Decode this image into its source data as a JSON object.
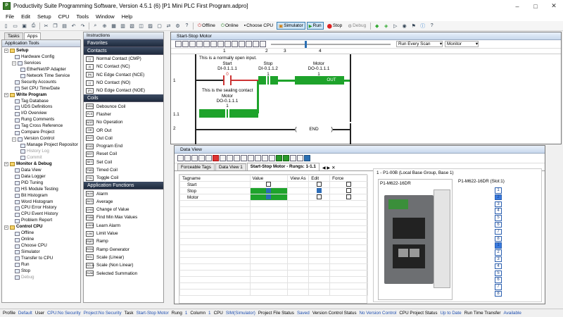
{
  "window": {
    "title": "Productivity Suite Programming Software, Version 4.5.1 (6)  [P1 Mini PLC First Program.adpro]"
  },
  "menu": [
    "File",
    "Edit",
    "Setup",
    "CPU",
    "Tools",
    "Window",
    "Help"
  ],
  "toolbar": {
    "offline": "Offline",
    "online": "Online",
    "choose_cpu": "Choose CPU",
    "simulator": "Simulator",
    "run": "Run",
    "stop": "Stop",
    "debug": "Debug"
  },
  "left_tabs": {
    "tasks": "Tasks",
    "apps": "Apps"
  },
  "app_tools": {
    "header": "Application Tools",
    "items": [
      {
        "label": "Setup",
        "type": "group"
      },
      {
        "label": "Hardware Config",
        "type": "item"
      },
      {
        "label": "Services",
        "type": "sub"
      },
      {
        "label": "EtherNet/IP Adapter",
        "type": "item2"
      },
      {
        "label": "Network Time Service",
        "type": "item2"
      },
      {
        "label": "Security Accounts",
        "type": "item"
      },
      {
        "label": "Set CPU Time/Date",
        "type": "item"
      },
      {
        "label": "Write Program",
        "type": "group"
      },
      {
        "label": "Tag Database",
        "type": "item"
      },
      {
        "label": "UDS Definitions",
        "type": "item"
      },
      {
        "label": "I/O Overview",
        "type": "item"
      },
      {
        "label": "Rung Comments",
        "type": "item"
      },
      {
        "label": "Tag Cross Reference",
        "type": "item"
      },
      {
        "label": "Compare Project",
        "type": "item"
      },
      {
        "label": "Version Control",
        "type": "sub"
      },
      {
        "label": "Manage Project Repositor",
        "type": "item2"
      },
      {
        "label": "History Log",
        "type": "item2dis"
      },
      {
        "label": "Commit",
        "type": "item2dis"
      },
      {
        "label": "Monitor & Debug",
        "type": "group"
      },
      {
        "label": "Data View",
        "type": "item"
      },
      {
        "label": "Data Logger",
        "type": "item"
      },
      {
        "label": "PID Tuning",
        "type": "item"
      },
      {
        "label": "HS Module Testing",
        "type": "item"
      },
      {
        "label": "Bit Histogram",
        "type": "item"
      },
      {
        "label": "Word Histogram",
        "type": "item"
      },
      {
        "label": "CPU Error History",
        "type": "item"
      },
      {
        "label": "CPU Event History",
        "type": "item"
      },
      {
        "label": "Problem Report",
        "type": "item"
      },
      {
        "label": "Control CPU",
        "type": "group"
      },
      {
        "label": "Offline",
        "type": "item"
      },
      {
        "label": "Online",
        "type": "item"
      },
      {
        "label": "Choose CPU",
        "type": "item"
      },
      {
        "label": "Simulator",
        "type": "item"
      },
      {
        "label": "Transfer to CPU",
        "type": "item"
      },
      {
        "label": "Run",
        "type": "item"
      },
      {
        "label": "Stop",
        "type": "item"
      },
      {
        "label": "Debug",
        "type": "itemdis"
      }
    ]
  },
  "instructions": {
    "header": "Instructions",
    "sections": [
      {
        "title": "Favorites",
        "items": []
      },
      {
        "title": "Contacts",
        "items": [
          {
            "label": "Normal Contact (CMP)",
            "icon": "| |"
          },
          {
            "label": "NC Contact (NC)",
            "icon": "|/|"
          },
          {
            "label": "NC Edge Contact (NCE)",
            "icon": "|N|"
          },
          {
            "label": "NO Contact (NO)",
            "icon": "| |"
          },
          {
            "label": "NO Edge Contact (NOE)",
            "icon": "|P|"
          }
        ]
      },
      {
        "title": "Coils",
        "items": [
          {
            "label": "Debounce Coil",
            "icon": "DBN"
          },
          {
            "label": "Flasher",
            "icon": "FLS"
          },
          {
            "label": "No Operation",
            "icon": "NOP"
          },
          {
            "label": "OR Out",
            "icon": "OR"
          },
          {
            "label": "Out Coil",
            "icon": "OUT"
          },
          {
            "label": "Program End",
            "icon": "END"
          },
          {
            "label": "Reset Coil",
            "icon": "RST"
          },
          {
            "label": "Set Coil",
            "icon": "SET"
          },
          {
            "label": "Timed Coil",
            "icon": "TMD"
          },
          {
            "label": "Toggle Coil",
            "icon": "TGL"
          }
        ]
      },
      {
        "title": "Application Functions",
        "items": [
          {
            "label": "Alarm",
            "icon": "ALM"
          },
          {
            "label": "Average",
            "icon": "AVG"
          },
          {
            "label": "Change of Value",
            "icon": "CHG"
          },
          {
            "label": "Find Min Max Values",
            "icon": "FMM"
          },
          {
            "label": "Learn Alarm",
            "icon": "LALM"
          },
          {
            "label": "Limit Value",
            "icon": "LIM"
          },
          {
            "label": "Ramp",
            "icon": "RMP"
          },
          {
            "label": "Ramp Generator",
            "icon": "RGN"
          },
          {
            "label": "Scale (Linear)",
            "icon": "SCL"
          },
          {
            "label": "Scale (Non Linear)",
            "icon": "SCLN"
          },
          {
            "label": "Selected Summation",
            "icon": "SUM"
          }
        ]
      }
    ]
  },
  "ladder": {
    "title": "Start-Stop Motor",
    "scan_mode": "Run Every Scan",
    "monitor": "Monitor",
    "columns": [
      "1",
      "2",
      "3",
      "4"
    ],
    "rung1": {
      "number": "1",
      "branch_number": "1.1",
      "comment1": "This is a normally open input.",
      "comment2": "This is the sealing contact",
      "start_name": "Start",
      "start_addr": "DI-0.1.1.1",
      "start_value": "0",
      "stop_name": "Stop",
      "stop_addr": "DI-0.1.1.2",
      "stop_value": "1",
      "motor_name": "Motor",
      "motor_addr": "DO-0.1.1.1",
      "motor_value": "1",
      "coil_label": "OUT",
      "seal_name": "Motor",
      "seal_addr": "DO-0.1.1.1",
      "seal_value": "1"
    },
    "rung2": {
      "number": "2",
      "label": "END"
    }
  },
  "data_view": {
    "title": "Data View",
    "tabs": [
      "Forceable Tags",
      "Data View 1",
      "Start-Stop Motor - Rungs: 1-1.1"
    ],
    "columns": {
      "tagname": "Tagname",
      "value": "Value",
      "view_as": "View As",
      "edit": "Edit",
      "force": "Force"
    },
    "rows": [
      {
        "tag": "Start",
        "value_on": false,
        "edit": false
      },
      {
        "tag": "Stop",
        "value_on": true,
        "edit": true
      },
      {
        "tag": "Motor",
        "value_on": true,
        "edit": false
      }
    ],
    "hw_title": "1 - P1-00B  (Local Base Group, Base 1)",
    "hw_left": "P1-M622-16DR",
    "hw_right": "P1-M622-16DR  (Slot:1)",
    "leds": [
      "1",
      "2",
      "3",
      "4",
      "5",
      "6",
      "7",
      "8",
      "1",
      "2",
      "3",
      "4",
      "5",
      "6",
      "7",
      "8"
    ]
  },
  "status": {
    "profile_label": "Profile",
    "profile": "Default",
    "user_label": "User",
    "user": "CPU:No Security",
    "project_label": "Project:No Security",
    "task_label": "Task",
    "task": "Start-Stop Motor",
    "rung_label": "Rung",
    "rung": "1",
    "column_label": "Column",
    "column": "1",
    "cpu_label": "CPU",
    "cpu": "SIM(Simulator)",
    "pfs_label": "Project File Status",
    "pfs": "Saved",
    "vcs_label": "Version Control Status",
    "vcs": "No Version Control",
    "cps_label": "CPU Project Status",
    "cps": "Up to Date",
    "rtt_label": "Run Time Transfer",
    "rtt": "Available"
  },
  "colors": {
    "energized": "#1ea32b",
    "checked": "#2d6db8"
  }
}
